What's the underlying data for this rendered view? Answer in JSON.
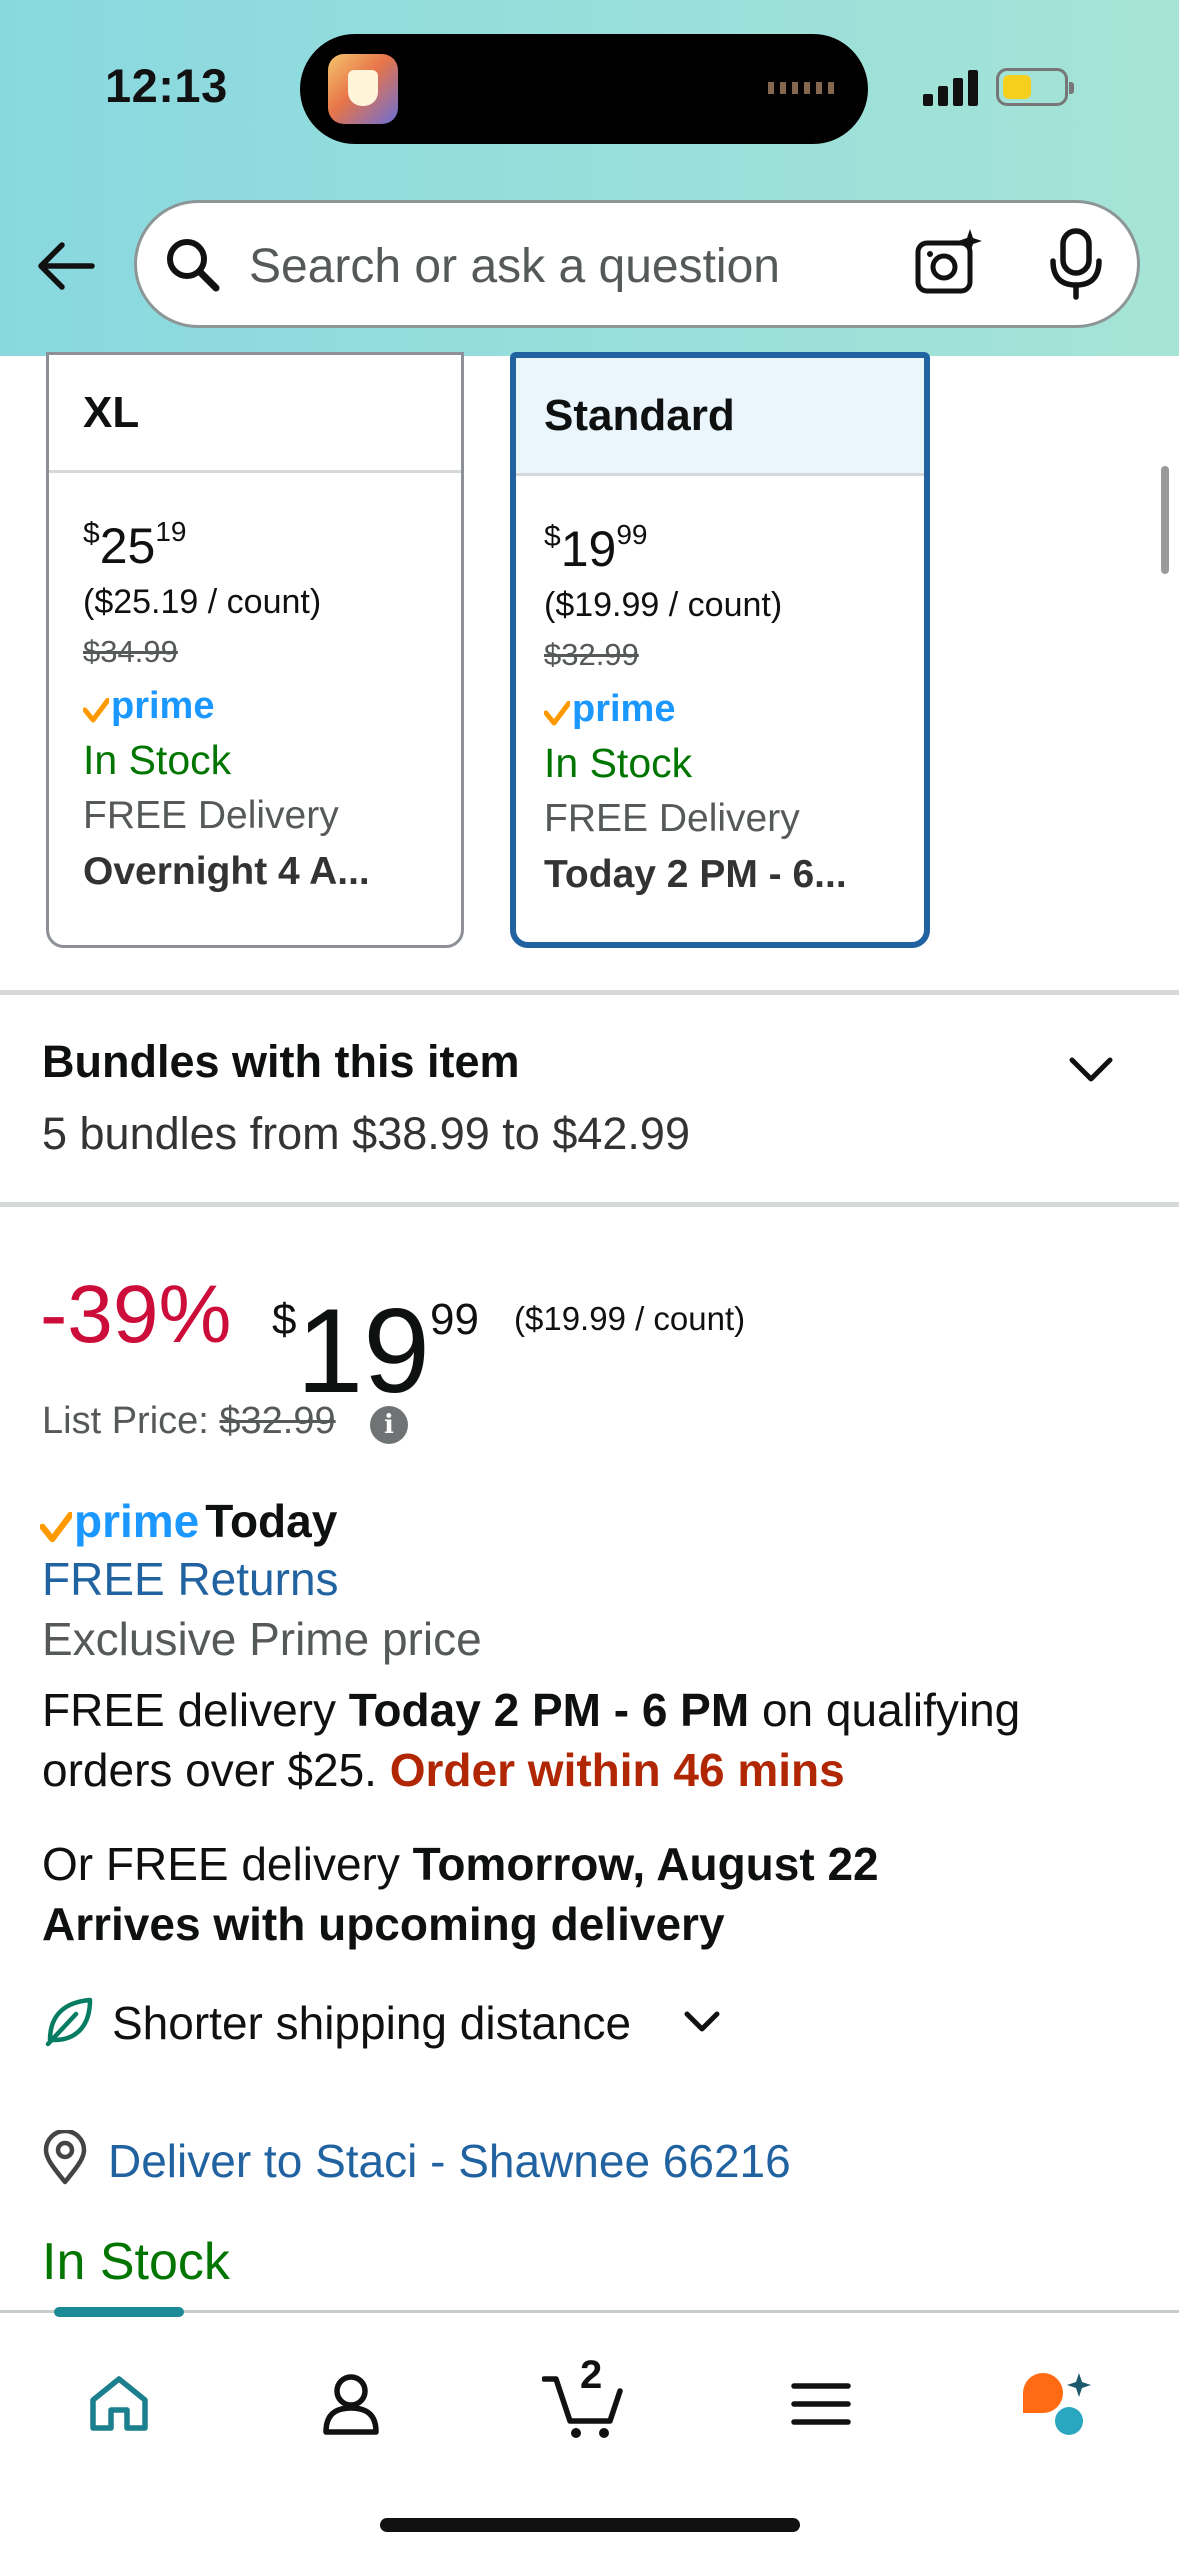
{
  "status_bar": {
    "time": "12:13"
  },
  "search": {
    "placeholder": "Search or ask a question"
  },
  "size_options": [
    {
      "name": "XL",
      "price_dollars": "25",
      "price_cents": "19",
      "unit_price": "($25.19 / count)",
      "list_price": "$34.99",
      "prime": "prime",
      "stock": "In Stock",
      "delivery": "FREE Delivery",
      "delivery_time": "Overnight 4 A...",
      "selected": false
    },
    {
      "name": "Standard",
      "price_dollars": "19",
      "price_cents": "99",
      "unit_price": "($19.99 / count)",
      "list_price": "$32.99",
      "prime": "prime",
      "stock": "In Stock",
      "delivery": "FREE Delivery",
      "delivery_time": "Today 2 PM - 6...",
      "selected": true
    }
  ],
  "bundles": {
    "title": "Bundles with this item",
    "subtitle": "5 bundles from $38.99 to $42.99"
  },
  "buybox": {
    "discount": "-39%",
    "currency": "$",
    "price_dollars": "19",
    "price_cents": "99",
    "unit_price": "($19.99 / count)",
    "list_price_label": "List Price:",
    "list_price": "$32.99",
    "prime_label": "prime",
    "prime_today": "Today",
    "free_returns": "FREE Returns",
    "exclusive": "Exclusive Prime price",
    "delivery_prefix": "FREE delivery",
    "delivery_window": "Today 2 PM - 6 PM",
    "delivery_suffix": "on qualifying orders over $25.",
    "order_within": "Order within 46 mins",
    "alt_prefix": "Or FREE delivery",
    "alt_date": "Tomorrow, August 22",
    "alt_note": "Arrives with upcoming delivery",
    "shipping_distance": "Shorter shipping distance",
    "deliver_to": "Deliver to Staci - Shawnee 66216",
    "stock": "In Stock"
  },
  "nav": {
    "items": [
      "home-icon",
      "account-icon",
      "cart-icon",
      "menu-icon",
      "rufus-icon"
    ],
    "cart_count": "2"
  },
  "colors": {
    "header_gradient_start": "#89d8e0",
    "header_gradient_end": "#a6e4d6",
    "discount_red": "#cc0c39",
    "link_blue": "#2162a1",
    "stock_green": "#007600",
    "urgent_red": "#b12704",
    "prime_blue": "#1a98ff",
    "prime_check": "#ff9900",
    "selected_border": "#2162a1"
  }
}
